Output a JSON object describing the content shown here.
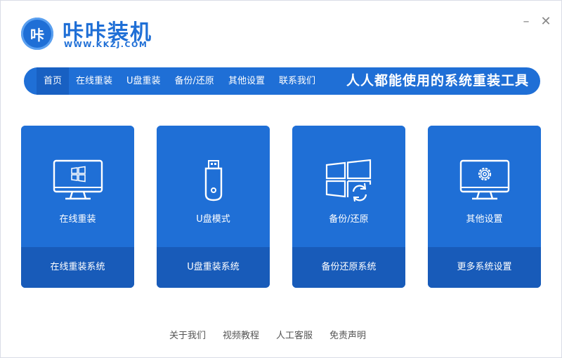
{
  "header": {
    "logo_text": "咔",
    "title": "咔咔装机",
    "url": "WWW.KKZJ.COM",
    "minimize": "–",
    "close": "✕"
  },
  "nav": {
    "items": [
      {
        "label": "首页",
        "active": true
      },
      {
        "label": "在线重装"
      },
      {
        "label": "U盘重装"
      },
      {
        "label": "备份/还原"
      },
      {
        "label": "其他设置"
      },
      {
        "label": "联系我们"
      }
    ],
    "slogan": "人人都能使用的系统重装工具"
  },
  "cards": [
    {
      "title": "在线重装",
      "action": "在线重装系统",
      "icon": "monitor-windows-icon"
    },
    {
      "title": "U盘模式",
      "action": "U盘重装系统",
      "icon": "usb-drive-icon"
    },
    {
      "title": "备份/还原",
      "action": "备份还原系统",
      "icon": "windows-restore-icon"
    },
    {
      "title": "其他设置",
      "action": "更多系统设置",
      "icon": "monitor-gear-icon"
    }
  ],
  "footer": {
    "links": [
      "关于我们",
      "视频教程",
      "人工客服",
      "免责声明"
    ]
  },
  "colors": {
    "brand": "#1f6fd6",
    "card_bottom": "#185bb9",
    "nav_active": "#1860c2"
  }
}
